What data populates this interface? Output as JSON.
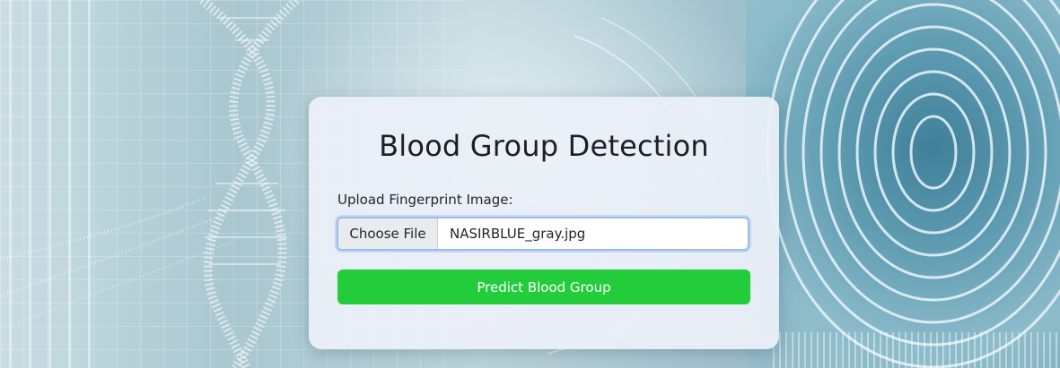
{
  "card": {
    "title": "Blood Group Detection",
    "upload_label": "Upload Fingerprint Image:",
    "file_input": {
      "button_label": "Choose File",
      "file_name": "NASIRBLUE_gray.jpg"
    },
    "predict_button_label": "Predict Blood Group"
  },
  "colors": {
    "predict_button": "#22cc3a",
    "input_focus_border": "#9bbcea",
    "card_background": "#eceff8",
    "title_text": "#1d1f24"
  },
  "icons": {
    "background_left": "dna-helix-icon",
    "background_right": "fingerprint-icon"
  }
}
